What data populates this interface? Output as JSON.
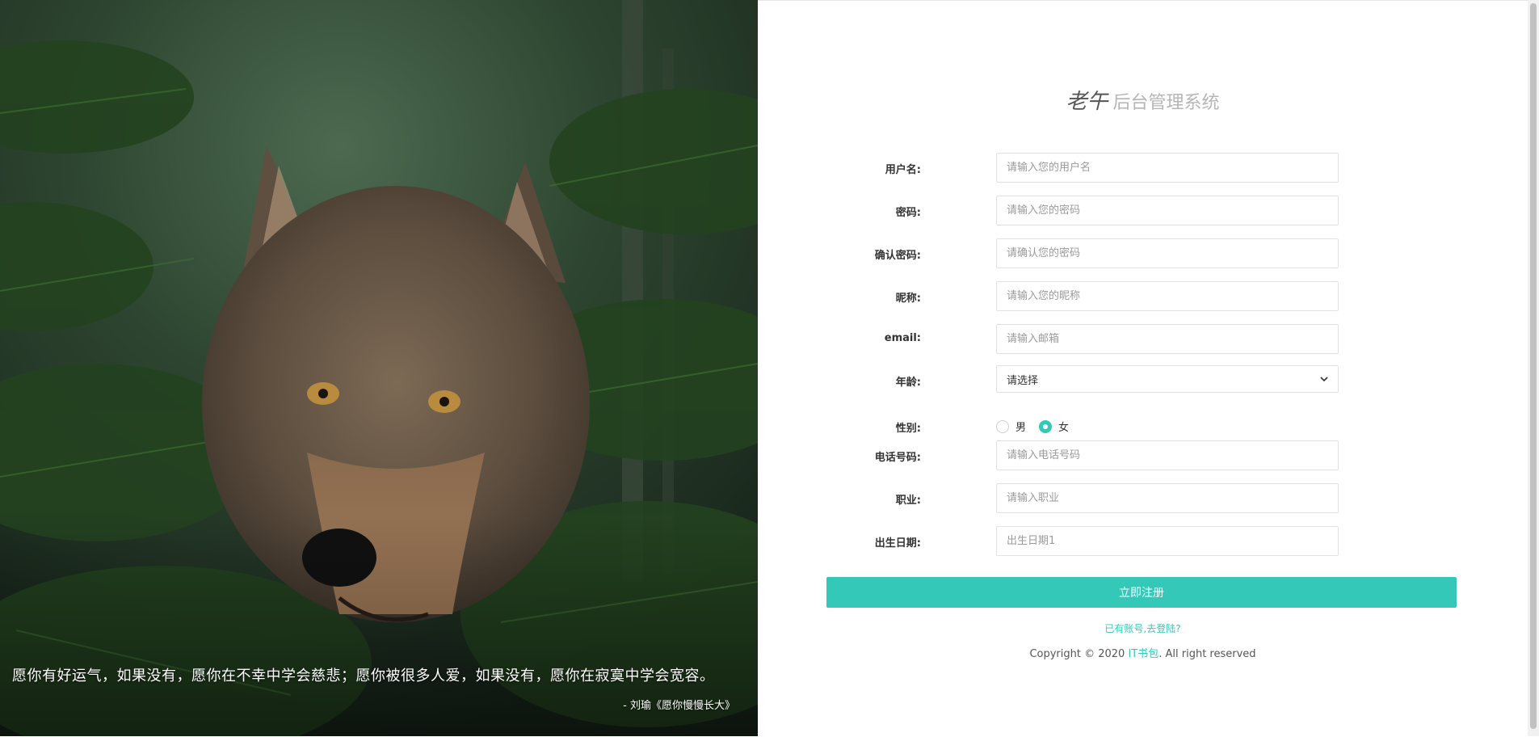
{
  "hero": {
    "quote": "愿你有好运气，如果没有，愿你在不幸中学会慈悲；愿你被很多人爱，如果没有，愿你在寂寞中学会宽容。",
    "author": "- 刘瑜《愿你慢慢长大》"
  },
  "header": {
    "logo": "老午",
    "title": "后台管理系统"
  },
  "form": {
    "username": {
      "label": "用户名:",
      "placeholder": "请输入您的用户名"
    },
    "password": {
      "label": "密码:",
      "placeholder": "请输入您的密码"
    },
    "confirm_password": {
      "label": "确认密码:",
      "placeholder": "请确认您的密码"
    },
    "nickname": {
      "label": "昵称:",
      "placeholder": "请输入您的昵称"
    },
    "email": {
      "label": "email:",
      "placeholder": "请输入邮箱"
    },
    "age": {
      "label": "年龄:",
      "selected": "请选择"
    },
    "gender": {
      "label": "性别:",
      "options": [
        "男",
        "女"
      ],
      "selected": "女"
    },
    "phone": {
      "label": "电话号码:",
      "placeholder": "请输入电话号码"
    },
    "job": {
      "label": "职业:",
      "placeholder": "请输入职业"
    },
    "birthday": {
      "label": "出生日期:",
      "placeholder": "出生日期1"
    },
    "submit_label": "立即注册"
  },
  "footer": {
    "login_link": "已有账号,去登陆?",
    "copyright_prefix": "Copyright © 2020 ",
    "brand": "IT书包",
    "copyright_suffix": ". All right reserved"
  },
  "colors": {
    "accent": "#34c8b9",
    "title": "#b5b5b5"
  }
}
